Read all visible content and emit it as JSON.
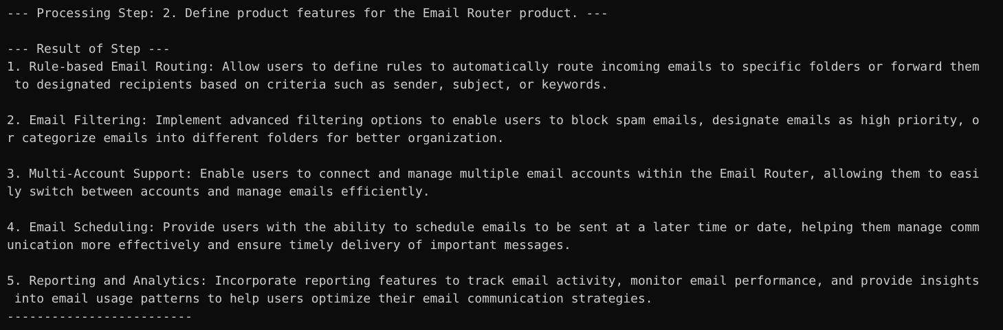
{
  "terminal": {
    "lines": [
      "--- Processing Step: 2. Define product features for the Email Router product. ---",
      "",
      "--- Result of Step ---",
      "1. Rule-based Email Routing: Allow users to define rules to automatically route incoming emails to specific folders or forward them",
      " to designated recipients based on criteria such as sender, subject, or keywords.",
      "",
      "2. Email Filtering: Implement advanced filtering options to enable users to block spam emails, designate emails as high priority, o",
      "r categorize emails into different folders for better organization.",
      "",
      "3. Multi-Account Support: Enable users to connect and manage multiple email accounts within the Email Router, allowing them to easi",
      "ly switch between accounts and manage emails efficiently.",
      "",
      "4. Email Scheduling: Provide users with the ability to schedule emails to be sent at a later time or date, helping them manage comm",
      "unication more effectively and ensure timely delivery of important messages.",
      "",
      "5. Reporting and Analytics: Incorporate reporting features to track email activity, monitor email performance, and provide insights",
      " into email usage patterns to help users optimize their email communication strategies.",
      "-------------------------"
    ]
  },
  "colors": {
    "background": "#0c0c0c",
    "text": "#cccccc"
  }
}
